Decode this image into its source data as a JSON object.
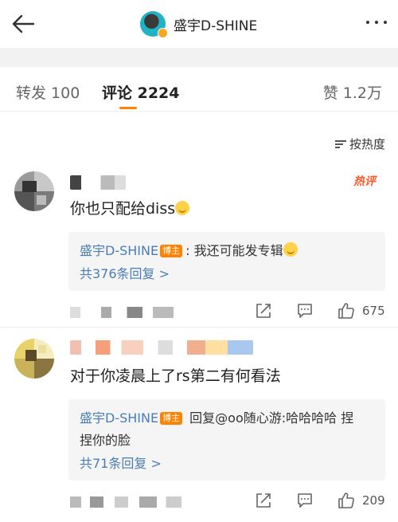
{
  "header": {
    "title": "盛宇D-SHINE",
    "back_icon": "back-arrow-icon",
    "more_icon": "more-dots-icon"
  },
  "tabs": [
    {
      "label": "转发 100",
      "active": false
    },
    {
      "label": "评论 2224",
      "active": true
    },
    {
      "label": "赞 1.2万",
      "active": false
    }
  ],
  "sort": {
    "label": "按热度",
    "icon": "sort-icon"
  },
  "accent_color": "#ff8200",
  "link_color": "#4a7db5",
  "comments": [
    {
      "badge": "热评",
      "text": "你也只配给diss",
      "emoji": "smile-emoji",
      "reply": {
        "user": "盛宇D-SHINE",
        "tag": "博主",
        "text": ": 我还可能发专辑",
        "count_label": "共376条回复 >"
      },
      "likes": "675"
    },
    {
      "badge": "",
      "text": "对于你凌晨上了rs第二有何看法",
      "reply": {
        "user": "盛宇D-SHINE",
        "tag": "博主",
        "text_line1": " 回复@oo随心游:哈哈哈哈 捏",
        "text_line2": "捏你的脸",
        "count_label": "共71条回复 >"
      },
      "likes": "209"
    }
  ]
}
